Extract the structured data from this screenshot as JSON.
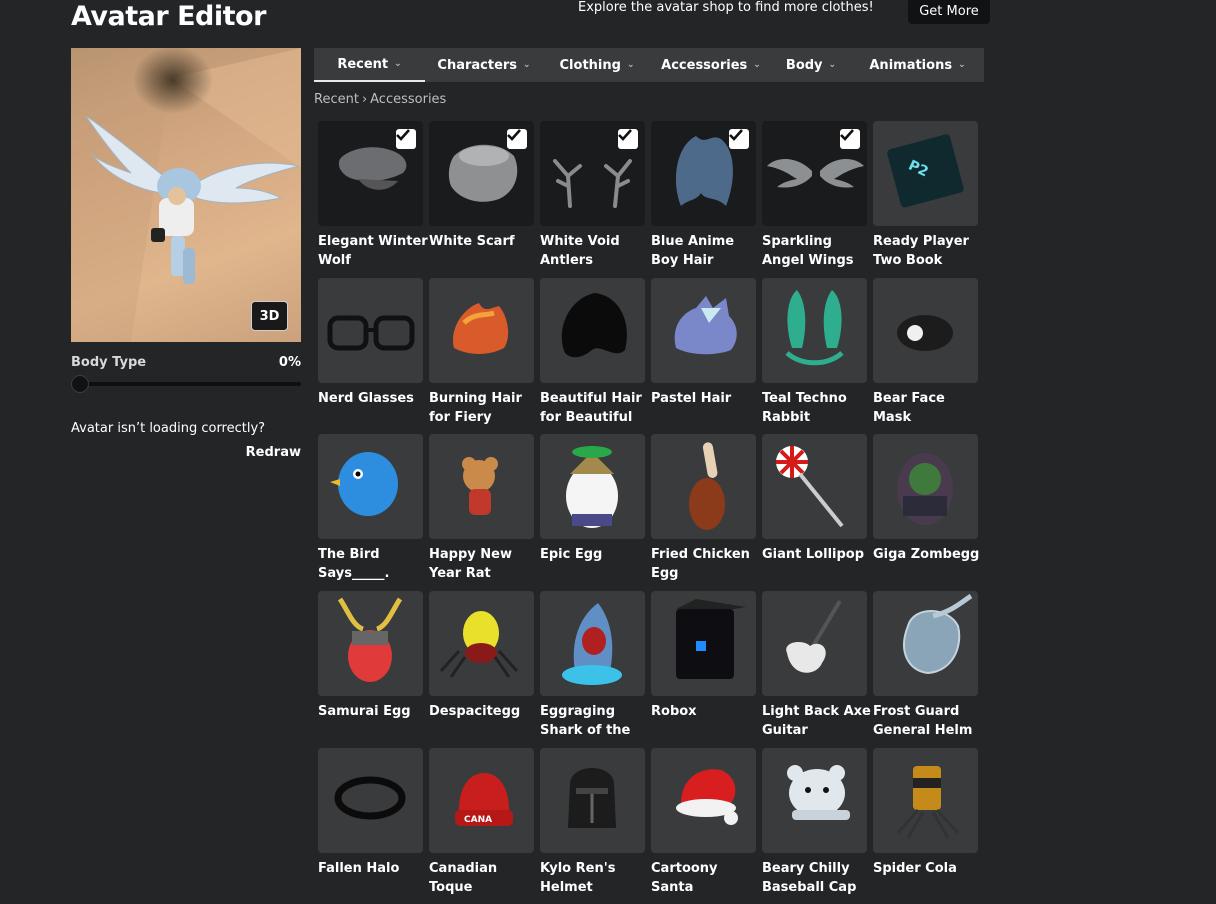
{
  "header": {
    "title": "Avatar Editor",
    "promo_text": "Explore the avatar shop to find more clothes!",
    "get_more_label": "Get More"
  },
  "preview": {
    "view_mode_label": "3D",
    "body_type_label": "Body Type",
    "body_type_value": "0%",
    "body_type_fraction": 0,
    "loading_question": "Avatar isn’t loading correctly?",
    "redraw_label": "Redraw"
  },
  "tabs": [
    {
      "label": "Recent",
      "active": true
    },
    {
      "label": "Characters",
      "active": false
    },
    {
      "label": "Clothing",
      "active": false
    },
    {
      "label": "Accessories",
      "active": false
    },
    {
      "label": "Body",
      "active": false
    },
    {
      "label": "Animations",
      "active": false
    }
  ],
  "breadcrumb": {
    "root": "Recent",
    "separator": "›",
    "current": "Accessories"
  },
  "items": [
    {
      "name": "Elegant Winter Wolf",
      "equipped": true,
      "icon": "wolf-hat-icon"
    },
    {
      "name": "White Scarf",
      "equipped": true,
      "icon": "scarf-icon"
    },
    {
      "name": "White Void Antlers",
      "equipped": true,
      "icon": "antlers-icon"
    },
    {
      "name": "Blue Anime Boy Hair",
      "equipped": true,
      "icon": "blue-hair-icon"
    },
    {
      "name": "Sparkling Angel Wings",
      "equipped": true,
      "icon": "wings-icon"
    },
    {
      "name": "Ready Player Two Book",
      "equipped": false,
      "icon": "book-icon"
    },
    {
      "name": "Nerd Glasses",
      "equipped": false,
      "icon": "glasses-icon"
    },
    {
      "name": "Burning Hair for Fiery",
      "equipped": false,
      "icon": "fire-hair-icon"
    },
    {
      "name": "Beautiful Hair for Beautiful",
      "equipped": false,
      "icon": "black-hair-icon"
    },
    {
      "name": "Pastel Hair",
      "equipped": false,
      "icon": "pastel-hair-icon"
    },
    {
      "name": "Teal Techno Rabbit",
      "equipped": false,
      "icon": "rabbit-ears-icon"
    },
    {
      "name": "Bear Face Mask",
      "equipped": false,
      "icon": "mask-icon"
    },
    {
      "name": "The Bird Says_____.",
      "equipped": false,
      "icon": "bird-icon"
    },
    {
      "name": "Happy New Year Rat",
      "equipped": false,
      "icon": "rat-icon"
    },
    {
      "name": "Epic Egg",
      "equipped": false,
      "icon": "epic-egg-icon"
    },
    {
      "name": "Fried Chicken Egg",
      "equipped": false,
      "icon": "drumstick-icon"
    },
    {
      "name": "Giant Lollipop",
      "equipped": false,
      "icon": "lollipop-icon"
    },
    {
      "name": "Giga Zombegg",
      "equipped": false,
      "icon": "zombie-egg-icon"
    },
    {
      "name": "Samurai Egg",
      "equipped": false,
      "icon": "samurai-egg-icon"
    },
    {
      "name": "Despacitegg",
      "equipped": false,
      "icon": "spider-egg-icon"
    },
    {
      "name": "Eggraging Shark of the",
      "equipped": false,
      "icon": "shark-icon"
    },
    {
      "name": "Robox",
      "equipped": false,
      "icon": "robox-icon"
    },
    {
      "name": "Light Back Axe Guitar",
      "equipped": false,
      "icon": "guitar-icon"
    },
    {
      "name": "Frost Guard General Helm",
      "equipped": false,
      "icon": "helm-icon"
    },
    {
      "name": "Fallen Halo",
      "equipped": false,
      "icon": "halo-icon"
    },
    {
      "name": "Canadian Toque",
      "equipped": false,
      "icon": "toque-icon"
    },
    {
      "name": "Kylo Ren's Helmet",
      "equipped": false,
      "icon": "kylo-helmet-icon"
    },
    {
      "name": "Cartoony Santa",
      "equipped": false,
      "icon": "santa-hat-icon"
    },
    {
      "name": "Beary Chilly Baseball Cap",
      "equipped": false,
      "icon": "bear-cap-icon"
    },
    {
      "name": "Spider Cola",
      "equipped": false,
      "icon": "spider-cola-icon"
    }
  ]
}
